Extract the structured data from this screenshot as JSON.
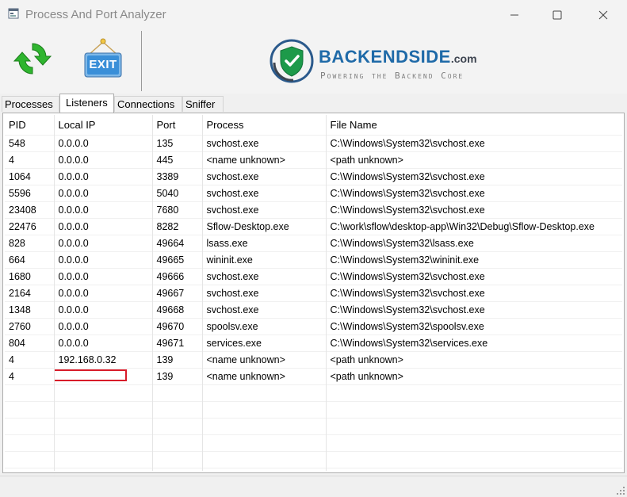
{
  "window": {
    "title": "Process And Port Analyzer"
  },
  "toolbar": {
    "exit_label": "EXIT"
  },
  "logo": {
    "name": "BACKENDSIDE",
    "suffix": ".com",
    "tagline": "Powering the Backend Core"
  },
  "tabs": [
    {
      "label": "Processes",
      "active": false
    },
    {
      "label": "Listeners",
      "active": true
    },
    {
      "label": "Connections",
      "active": false
    },
    {
      "label": "Sniffer",
      "active": false
    }
  ],
  "table": {
    "columns": [
      "PID",
      "Local IP",
      "Port",
      "Process",
      "File Name"
    ],
    "rows": [
      [
        "548",
        "0.0.0.0",
        "135",
        "svchost.exe",
        "C:\\Windows\\System32\\svchost.exe"
      ],
      [
        "4",
        "0.0.0.0",
        "445",
        "<name unknown>",
        "<path unknown>"
      ],
      [
        "1064",
        "0.0.0.0",
        "3389",
        "svchost.exe",
        "C:\\Windows\\System32\\svchost.exe"
      ],
      [
        "5596",
        "0.0.0.0",
        "5040",
        "svchost.exe",
        "C:\\Windows\\System32\\svchost.exe"
      ],
      [
        "23408",
        "0.0.0.0",
        "7680",
        "svchost.exe",
        "C:\\Windows\\System32\\svchost.exe"
      ],
      [
        "22476",
        "0.0.0.0",
        "8282",
        "Sflow-Desktop.exe",
        "C:\\work\\sflow\\desktop-app\\Win32\\Debug\\Sflow-Desktop.exe"
      ],
      [
        "828",
        "0.0.0.0",
        "49664",
        "lsass.exe",
        "C:\\Windows\\System32\\lsass.exe"
      ],
      [
        "664",
        "0.0.0.0",
        "49665",
        "wininit.exe",
        "C:\\Windows\\System32\\wininit.exe"
      ],
      [
        "1680",
        "0.0.0.0",
        "49666",
        "svchost.exe",
        "C:\\Windows\\System32\\svchost.exe"
      ],
      [
        "2164",
        "0.0.0.0",
        "49667",
        "svchost.exe",
        "C:\\Windows\\System32\\svchost.exe"
      ],
      [
        "1348",
        "0.0.0.0",
        "49668",
        "svchost.exe",
        "C:\\Windows\\System32\\svchost.exe"
      ],
      [
        "2760",
        "0.0.0.0",
        "49670",
        "spoolsv.exe",
        "C:\\Windows\\System32\\spoolsv.exe"
      ],
      [
        "804",
        "0.0.0.0",
        "49671",
        "services.exe",
        "C:\\Windows\\System32\\services.exe"
      ],
      [
        "4",
        "192.168.0.32",
        "139",
        "<name unknown>",
        "<path unknown>"
      ],
      [
        "4",
        "",
        "139",
        "<name unknown>",
        "<path unknown>"
      ]
    ],
    "redacted_row": 14
  },
  "colors": {
    "logo_blue": "#1f6aa8",
    "refresh_green": "#2fb52f",
    "exit_blue": "#3a8fd8",
    "redaction_red": "#d81b2a"
  },
  "icons": {
    "refresh": "refresh-icon",
    "exit": "exit-sign-icon",
    "shield": "shield-check-icon"
  }
}
